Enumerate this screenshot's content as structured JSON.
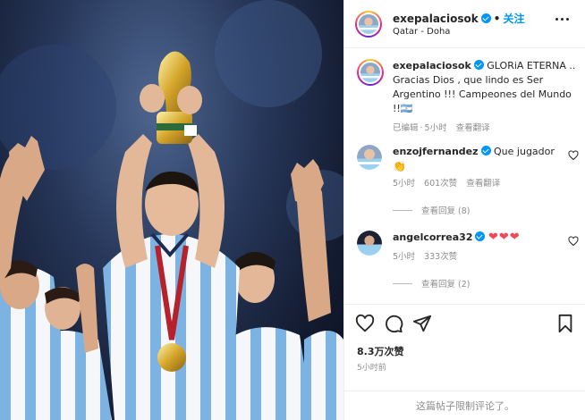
{
  "post": {
    "username": "exepalaciosok",
    "follow_label": "关注",
    "location": "Qatar - Doha",
    "caption_username": "exepalaciosok",
    "caption": "GLORiA ETERNA .. Gracias Dios , que lindo es Ser Argentino !!! Campeones del Mundo !!🇦🇷",
    "edited_label": "已编辑",
    "caption_time": "5小时",
    "translate_label": "查看翻译"
  },
  "comments": [
    {
      "username": "enzojfernandez",
      "text": "Que jugador",
      "emoji": "👏",
      "time": "5小时",
      "likes": "601次赞",
      "translate": "查看翻译",
      "replies": "查看回复 (8)"
    },
    {
      "username": "angelcorrea32",
      "emoji": "❤❤❤",
      "time": "5小时",
      "likes": "333次赞",
      "replies": "查看回复 (2)"
    }
  ],
  "actions": {
    "like_icon": "heart-icon",
    "comment_icon": "comment-icon",
    "share_icon": "send-icon",
    "save_icon": "bookmark-icon"
  },
  "footer": {
    "likes": "8.3万次赞",
    "time": "5小时前",
    "limited": "这篇帖子限制评论了。"
  },
  "colors": {
    "accent": "#0095f6",
    "heart_red": "#ed4956",
    "muted": "#8e8e8e",
    "jersey_blue": "#75aadb"
  }
}
